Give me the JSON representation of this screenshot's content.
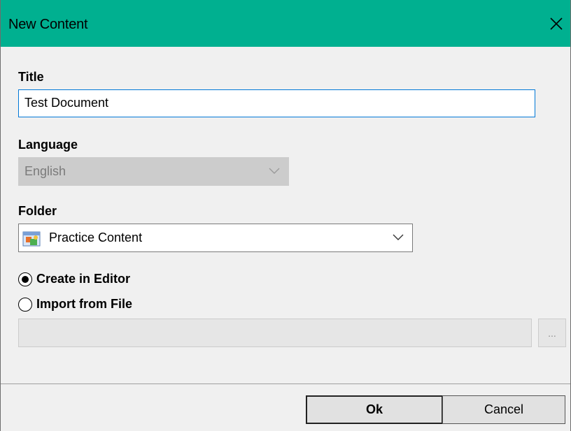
{
  "window": {
    "title": "New Content",
    "accent": "#00b090"
  },
  "title_field": {
    "label": "Title",
    "value": "Test Document"
  },
  "language_field": {
    "label": "Language",
    "value": "English",
    "disabled": true
  },
  "folder_field": {
    "label": "Folder",
    "value": "Practice Content",
    "icon": "folder-content-icon"
  },
  "creation_mode": {
    "options": [
      {
        "label": "Create in Editor",
        "selected": true
      },
      {
        "label": "Import from File",
        "selected": false
      }
    ]
  },
  "import_file": {
    "value": "",
    "browse_label": "..."
  },
  "buttons": {
    "ok": "Ok",
    "cancel": "Cancel"
  }
}
